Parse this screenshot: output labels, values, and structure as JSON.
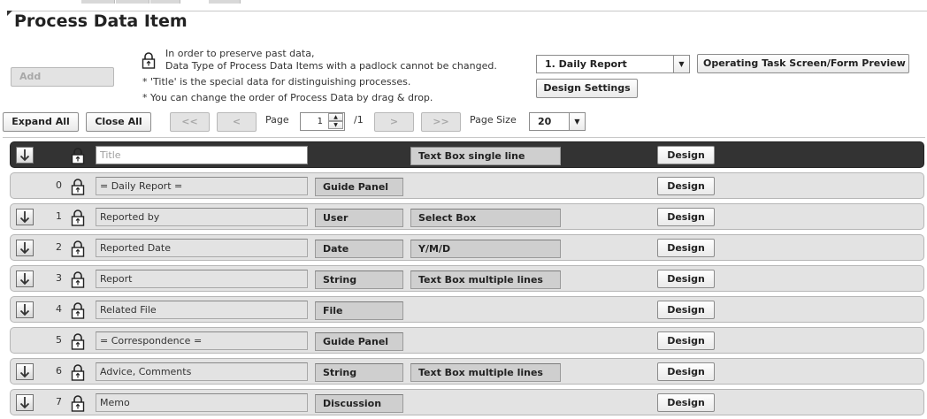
{
  "page": {
    "title": "Process Data Item"
  },
  "toolbar": {
    "add_label": "Add",
    "padlock_notice_line1": "In order to preserve past data,",
    "padlock_notice_line2": "Data Type of Process Data Items with a padlock cannot be changed.",
    "note_title": "* 'Title' is the special data for distinguishing processes.",
    "note_order": "* You can change the order of Process Data by drag & drop.",
    "process_select_value": "1. Daily Report",
    "preview_label": "Operating Task Screen/Form Preview",
    "design_settings_label": "Design Settings"
  },
  "pager": {
    "expand_all_label": "Expand All",
    "close_all_label": "Close All",
    "first_label": "<<",
    "prev_label": "<",
    "page_label": "Page",
    "page_value": "1",
    "page_total": "/1",
    "next_label": ">",
    "last_label": ">>",
    "page_size_label": "Page Size",
    "page_size_value": "20"
  },
  "rows": [
    {
      "num": "",
      "name": "Title",
      "type": "",
      "subtype": "Text Box single line",
      "design_label": "Design",
      "expandable": true,
      "header": true
    },
    {
      "num": "0",
      "name": "= Daily Report =",
      "type": "Guide Panel",
      "subtype": "",
      "design_label": "Design",
      "expandable": false
    },
    {
      "num": "1",
      "name": "Reported by",
      "type": "User",
      "subtype": "Select Box",
      "design_label": "Design",
      "expandable": true
    },
    {
      "num": "2",
      "name": "Reported Date",
      "type": "Date",
      "subtype": "Y/M/D",
      "design_label": "Design",
      "expandable": true
    },
    {
      "num": "3",
      "name": "Report",
      "type": "String",
      "subtype": "Text Box multiple lines",
      "design_label": "Design",
      "expandable": true
    },
    {
      "num": "4",
      "name": "Related File",
      "type": "File",
      "subtype": "",
      "design_label": "Design",
      "expandable": true
    },
    {
      "num": "5",
      "name": "= Correspondence =",
      "type": "Guide Panel",
      "subtype": "",
      "design_label": "Design",
      "expandable": false
    },
    {
      "num": "6",
      "name": "Advice, Comments",
      "type": "String",
      "subtype": "Text Box multiple lines",
      "design_label": "Design",
      "expandable": true
    },
    {
      "num": "7",
      "name": "Memo",
      "type": "Discussion",
      "subtype": "",
      "design_label": "Design",
      "expandable": true
    }
  ]
}
